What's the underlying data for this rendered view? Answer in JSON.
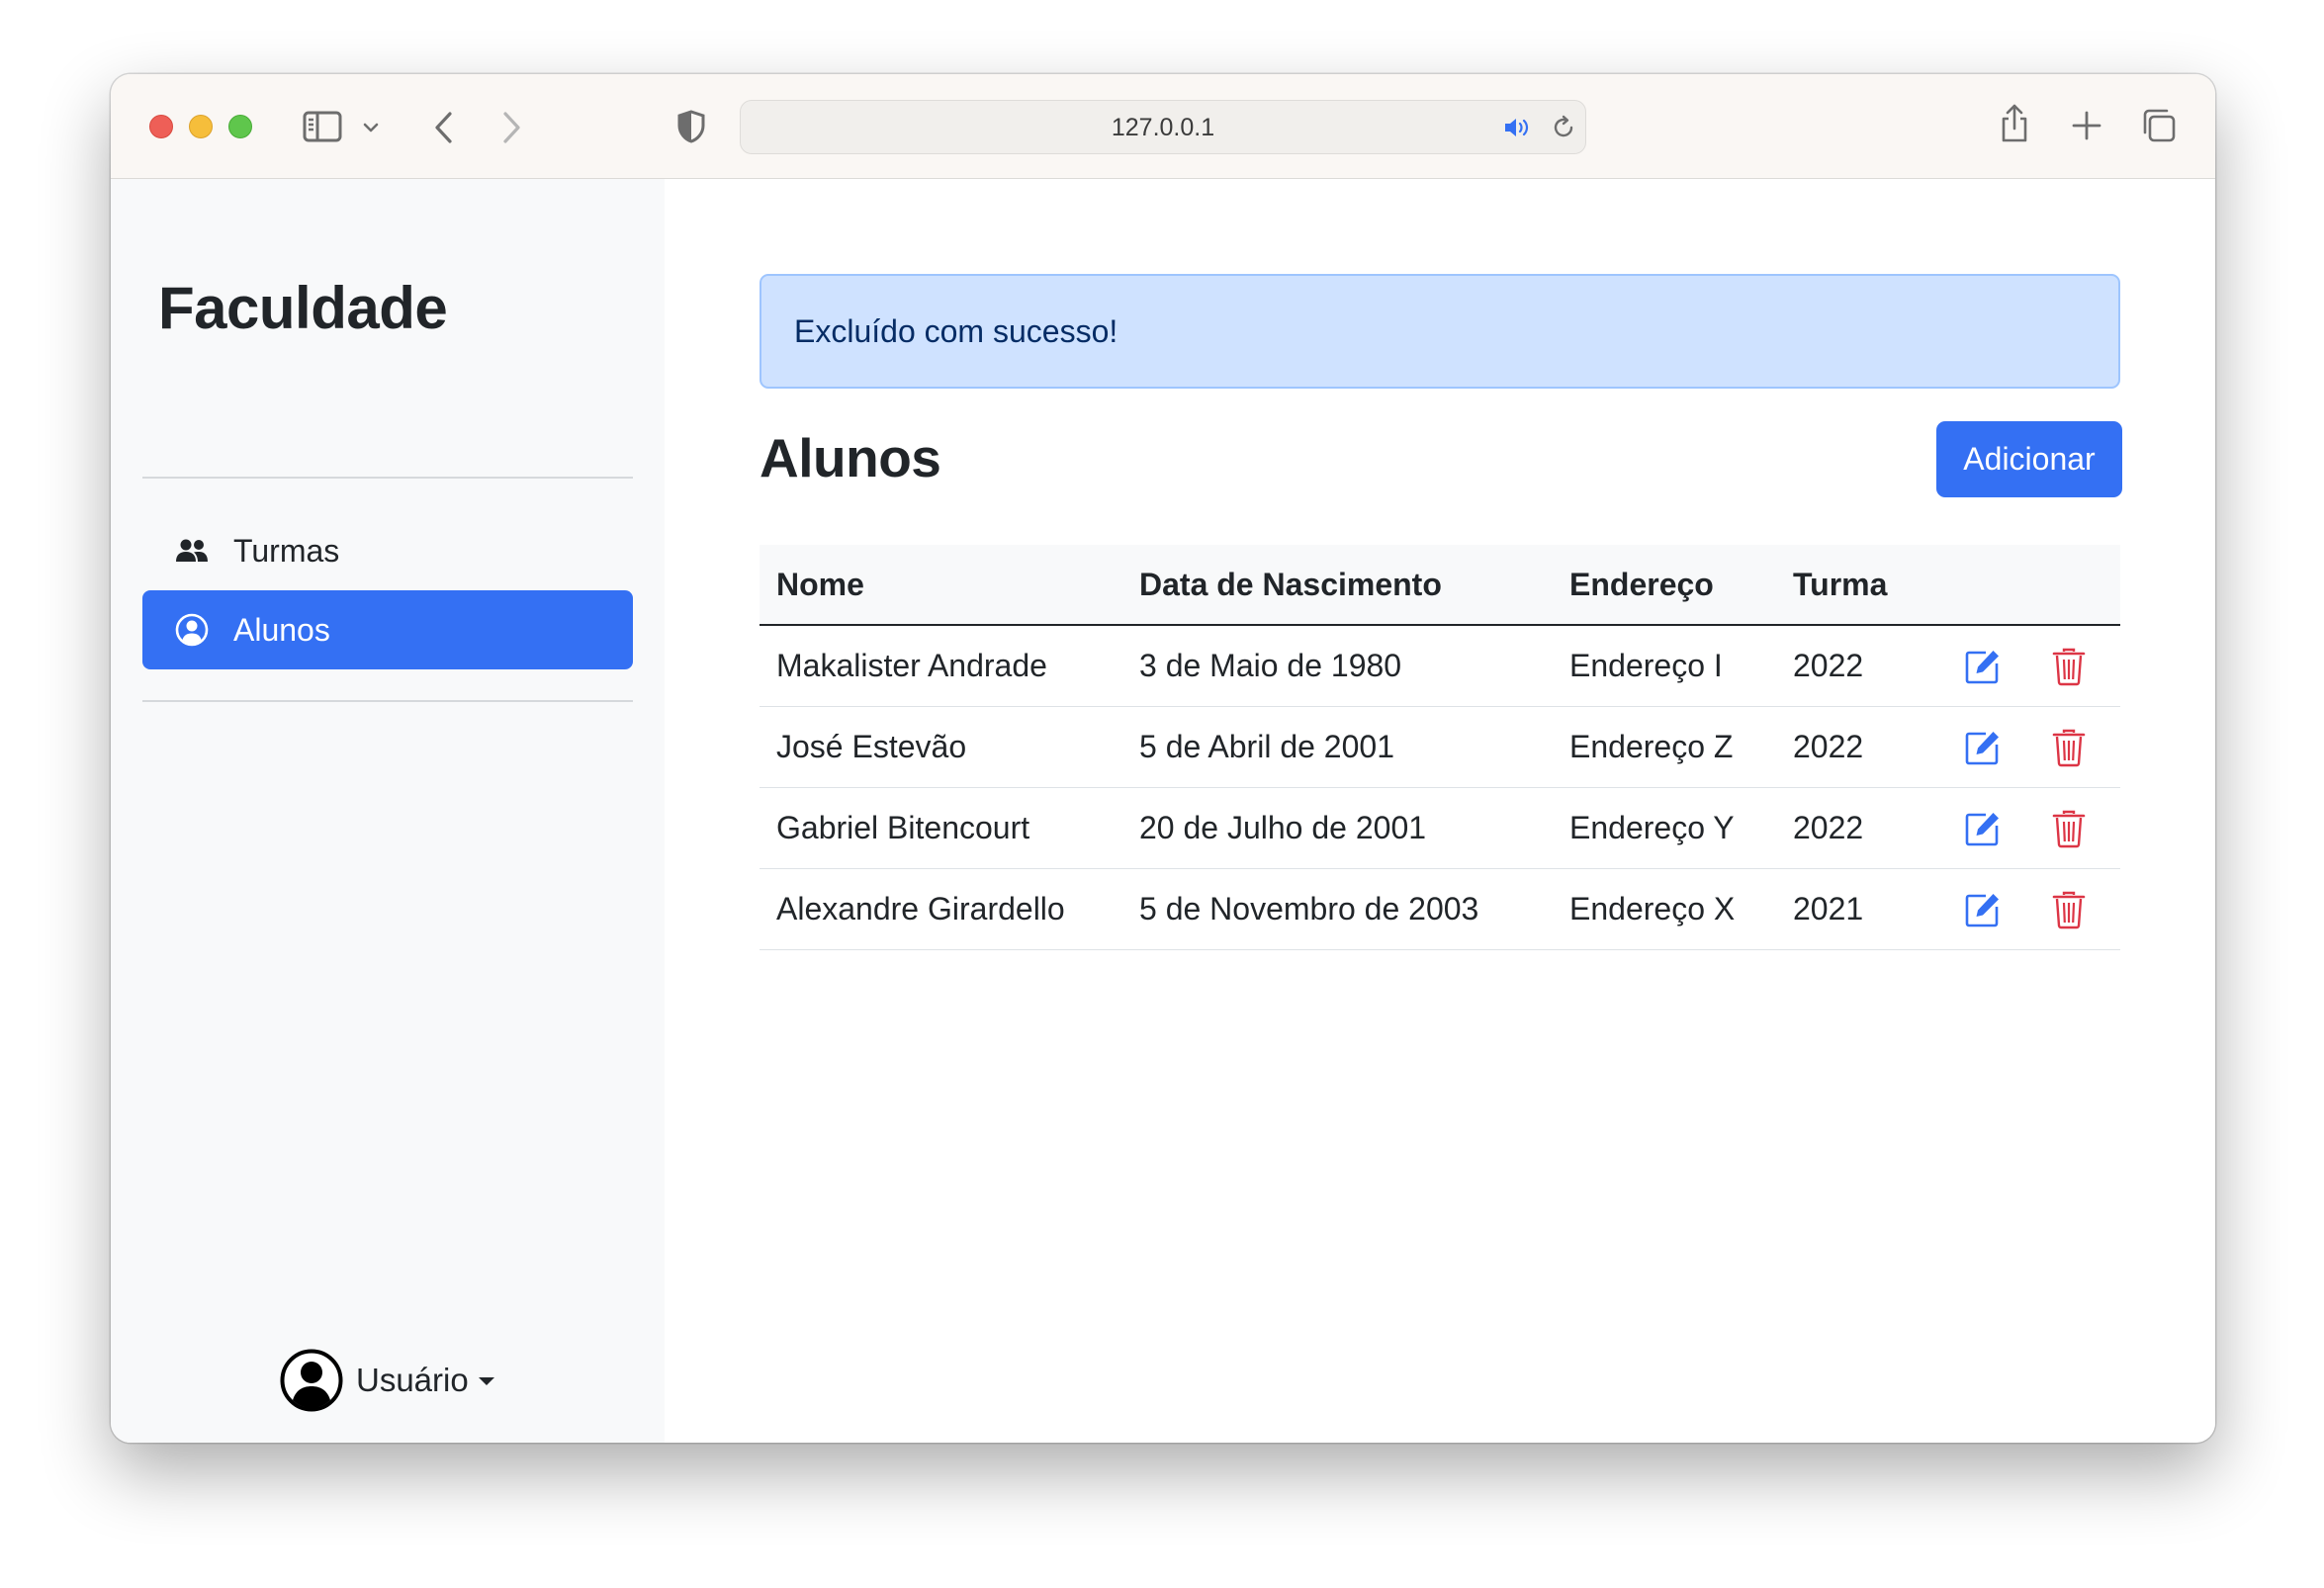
{
  "browser": {
    "url": "127.0.0.1"
  },
  "sidebar": {
    "brand": "Faculdade",
    "items": [
      {
        "label": "Turmas",
        "icon": "people-icon",
        "active": false
      },
      {
        "label": "Alunos",
        "icon": "person-circle-icon",
        "active": true
      }
    ],
    "user": {
      "label": "Usuário",
      "icon": "user-avatar-icon"
    }
  },
  "main": {
    "alert": "Excluído com sucesso!",
    "title": "Alunos",
    "add_button": "Adicionar",
    "table": {
      "headers": [
        "Nome",
        "Data de Nascimento",
        "Endereço",
        "Turma"
      ],
      "rows": [
        {
          "nome": "Makalister Andrade",
          "data": "3 de Maio de 1980",
          "endereco": "Endereço I",
          "turma": "2022"
        },
        {
          "nome": "José Estevão",
          "data": "5 de Abril de 2001",
          "endereco": "Endereço Z",
          "turma": "2022"
        },
        {
          "nome": "Gabriel Bitencourt",
          "data": "20 de Julho de 2001",
          "endereco": "Endereço Y",
          "turma": "2022"
        },
        {
          "nome": "Alexandre Girardello",
          "data": "5 de Novembro de 2003",
          "endereco": "Endereço X",
          "turma": "2021"
        }
      ]
    }
  },
  "colors": {
    "primary": "#3470f3",
    "danger": "#dc3545",
    "alert_bg": "#cfe2ff",
    "alert_text": "#052c65",
    "sidebar_bg": "#f8f9fa"
  }
}
